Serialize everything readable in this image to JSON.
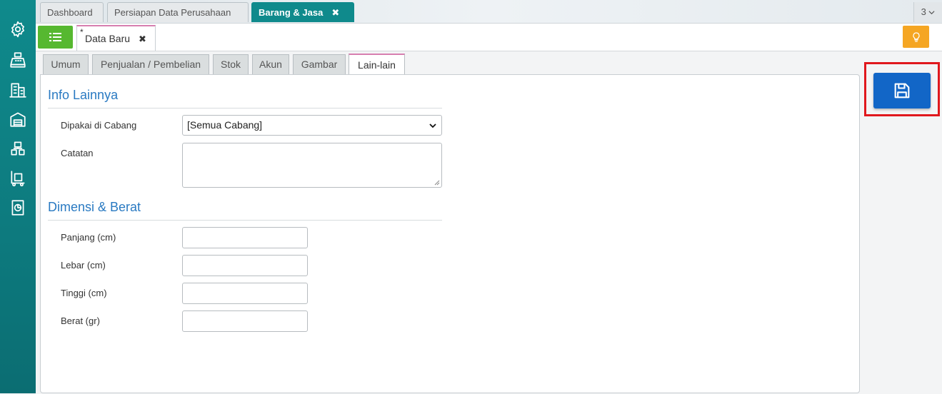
{
  "top_tabs": [
    {
      "label": "Dashboard"
    },
    {
      "label": "Persiapan Data Perusahaan"
    },
    {
      "label": "Barang & Jasa",
      "close": "✖"
    }
  ],
  "tab_count": "3",
  "document": {
    "modified_marker": "*",
    "tab_label": "Data Baru",
    "close": "✖"
  },
  "inner_tabs": [
    "Umum",
    "Penjualan / Pembelian",
    "Stok",
    "Akun",
    "Gambar",
    "Lain-lain"
  ],
  "info_section": {
    "title": "Info Lainnya",
    "branch_label": "Dipakai di Cabang",
    "branch_value": "[Semua Cabang]",
    "notes_label": "Catatan",
    "notes_value": ""
  },
  "dimension_section": {
    "title": "Dimensi & Berat",
    "fields": [
      {
        "label": "Panjang (cm)",
        "value": ""
      },
      {
        "label": "Lebar (cm)",
        "value": ""
      },
      {
        "label": "Tinggi (cm)",
        "value": ""
      },
      {
        "label": "Berat (gr)",
        "value": ""
      }
    ]
  },
  "colors": {
    "rail": "#0f8a8c",
    "list_button": "#56b830",
    "hint_button": "#f5a623",
    "save_button": "#1266c7",
    "highlight": "#e0181d",
    "section_title": "#2a7ac2"
  }
}
